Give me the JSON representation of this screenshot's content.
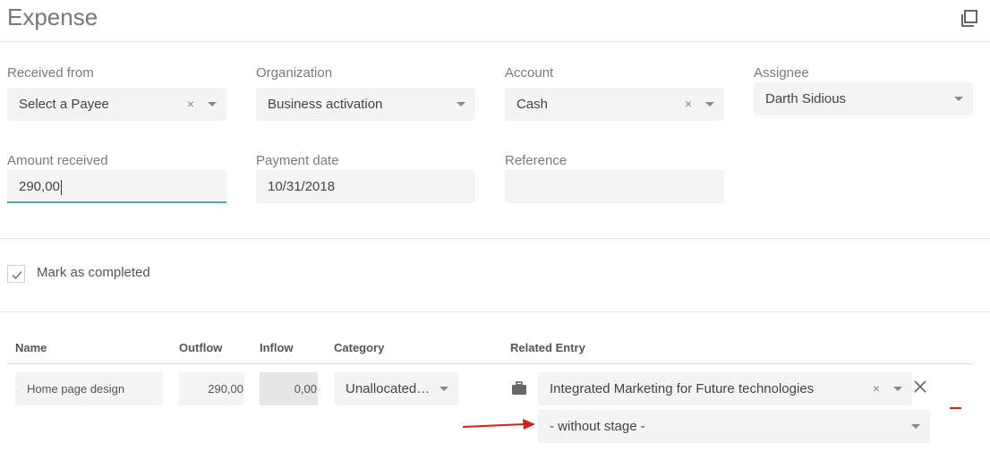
{
  "header": {
    "title": "Expense",
    "expand_icon": "copy-window-icon"
  },
  "fields": {
    "received_from": {
      "label": "Received from",
      "value": "Select a Payee",
      "clear": "×"
    },
    "organization": {
      "label": "Organization",
      "value": "Business activation"
    },
    "account": {
      "label": "Account",
      "value": "Cash",
      "clear": "×"
    },
    "assignee": {
      "label": "Assignee",
      "value": "Darth Sidious"
    },
    "amount_received": {
      "label": "Amount received",
      "value": "290,00"
    },
    "payment_date": {
      "label": "Payment date",
      "value": "10/31/2018"
    },
    "reference": {
      "label": "Reference",
      "value": ""
    }
  },
  "completed": {
    "label": "Mark as completed",
    "checked": true
  },
  "table": {
    "headers": {
      "name": "Name",
      "outflow": "Outflow",
      "inflow": "Inflow",
      "category": "Category",
      "related": "Related Entry"
    },
    "row": {
      "name": "Home page design",
      "outflow": "290,00",
      "inflow": "0,00",
      "category": "Unallocated…",
      "related_entry": "Integrated Marketing for Future technologies",
      "related_clear": "×",
      "stage": "- without stage -"
    }
  },
  "colors": {
    "accent": "#37b4b3",
    "danger": "#d81e1e",
    "field_bg": "#f4f4f4"
  }
}
